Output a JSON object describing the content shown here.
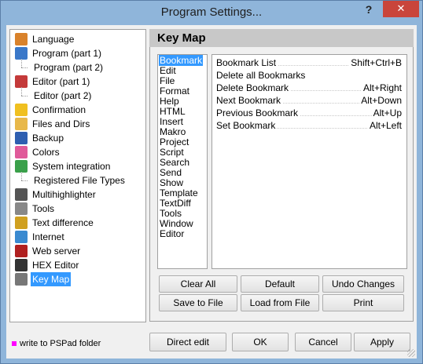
{
  "window": {
    "title": "Program Settings...",
    "help_glyph": "?",
    "close_glyph": "✕"
  },
  "tree": {
    "items": [
      {
        "label": "Language",
        "icon": "language-icon",
        "color": "#d9822b"
      },
      {
        "label": "Program  (part 1)",
        "icon": "program-icon",
        "color": "#3a78c9"
      },
      {
        "label": "Program  (part 2)",
        "icon": "",
        "color": ""
      },
      {
        "label": "Editor  (part 1)",
        "icon": "editor-icon",
        "color": "#c43a3a"
      },
      {
        "label": "Editor  (part 2)",
        "icon": "",
        "color": ""
      },
      {
        "label": "Confirmation",
        "icon": "confirmation-icon",
        "color": "#f0c020"
      },
      {
        "label": "Files and Dirs",
        "icon": "folder-icon",
        "color": "#e8b84a"
      },
      {
        "label": "Backup",
        "icon": "backup-icon",
        "color": "#2f5fb0"
      },
      {
        "label": "Colors",
        "icon": "colors-icon",
        "color": "#e05a9a"
      },
      {
        "label": "System integration",
        "icon": "windows-icon",
        "color": "#3aa04a"
      },
      {
        "label": "Registered File Types",
        "icon": "",
        "color": ""
      },
      {
        "label": "Multihighlighter",
        "icon": "highlighter-icon",
        "color": "#555555"
      },
      {
        "label": "Tools",
        "icon": "tools-icon",
        "color": "#888888"
      },
      {
        "label": "Text difference",
        "icon": "text-diff-icon",
        "color": "#d0a020"
      },
      {
        "label": "Internet",
        "icon": "globe-icon",
        "color": "#3a8ad0"
      },
      {
        "label": "Web server",
        "icon": "feather-icon",
        "color": "#b02020"
      },
      {
        "label": "HEX Editor",
        "icon": "hex-icon",
        "color": "#333333"
      },
      {
        "label": "Key Map",
        "icon": "keymap-icon",
        "color": "#777777"
      }
    ]
  },
  "panel": {
    "title": "Key Map"
  },
  "categories": [
    "Bookmark",
    "Edit",
    "File",
    "Format",
    "Help",
    "HTML",
    "Insert",
    "Makro",
    "Project",
    "Script",
    "Search",
    "Send",
    "Show",
    "Template",
    "TextDiff",
    "Tools",
    "Window",
    "Editor"
  ],
  "commands": [
    {
      "name": "Bookmark List",
      "key": "Shift+Ctrl+B"
    },
    {
      "name": "Delete all Bookmarks",
      "key": ""
    },
    {
      "name": "Delete Bookmark",
      "key": "Alt+Right"
    },
    {
      "name": "Next Bookmark",
      "key": "Alt+Down"
    },
    {
      "name": "Previous Bookmark",
      "key": "Alt+Up"
    },
    {
      "name": "Set Bookmark",
      "key": "Alt+Left"
    }
  ],
  "buttons": {
    "clear_all": "Clear All",
    "default": "Default",
    "undo_changes": "Undo Changes",
    "save_to_file": "Save to File",
    "load_from_file": "Load from File",
    "print": "Print",
    "direct_edit": "Direct edit",
    "ok": "OK",
    "cancel": "Cancel",
    "apply": "Apply"
  },
  "footer": {
    "note": "write to PSPad folder",
    "marker_color": "#ff00ff"
  }
}
